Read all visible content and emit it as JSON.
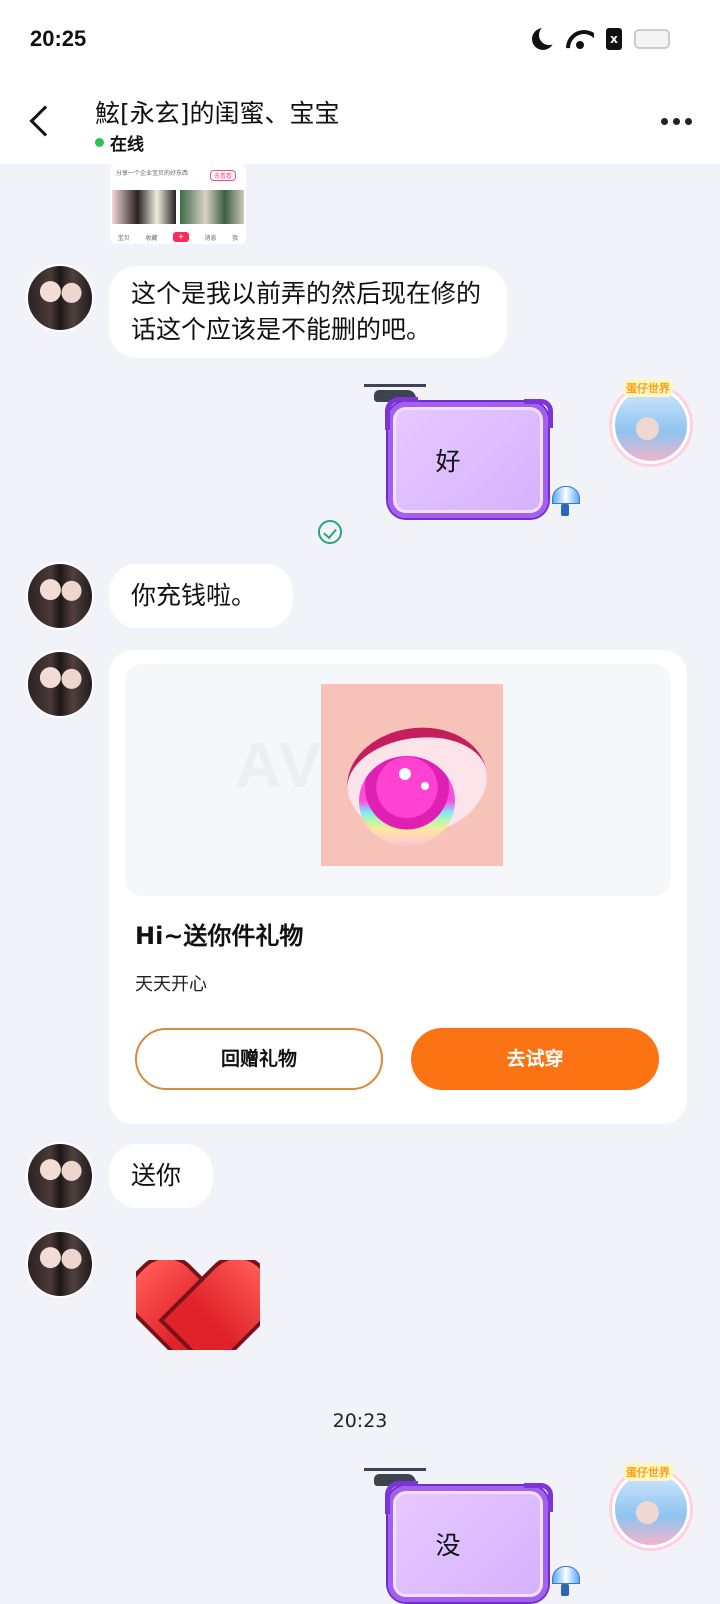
{
  "status_bar": {
    "time": "20:25",
    "icons": [
      "moon-icon",
      "wifi-icon",
      "sim-icon",
      "battery-icon"
    ],
    "sim_label": "x"
  },
  "header": {
    "title": "鮌[永玄]的闺蜜、宝宝",
    "status": "在线",
    "status_color": "#2cc25b"
  },
  "shared_card": {
    "title": "分享一个企业宝贝的好东西",
    "tag": "去看看",
    "nav": [
      "宝贝",
      "收藏",
      "+",
      "消息",
      "我"
    ]
  },
  "messages": [
    {
      "side": "left",
      "type": "text",
      "text": "这个是我以前弄的然后现在修的话这个应该是不能删的吧。"
    },
    {
      "side": "right",
      "type": "decorated_text",
      "text": "好",
      "status": "sent"
    },
    {
      "side": "left",
      "type": "text",
      "text": "你充钱啦。"
    },
    {
      "side": "left",
      "type": "gift_card"
    },
    {
      "side": "left",
      "type": "text",
      "text": "送你"
    },
    {
      "side": "left",
      "type": "sticker",
      "sticker": "heart"
    },
    {
      "side": "right",
      "type": "decorated_text",
      "text": "没"
    }
  ],
  "gift_card": {
    "watermark": "AVATAR",
    "title": "Hi~送你件礼物",
    "subtitle": "天天开心",
    "return_button": "回赠礼物",
    "try_button": "去试穿",
    "accent_color": "#fb7312"
  },
  "my_avatar_badge": "蛋仔世界",
  "timestamp": "20:23"
}
